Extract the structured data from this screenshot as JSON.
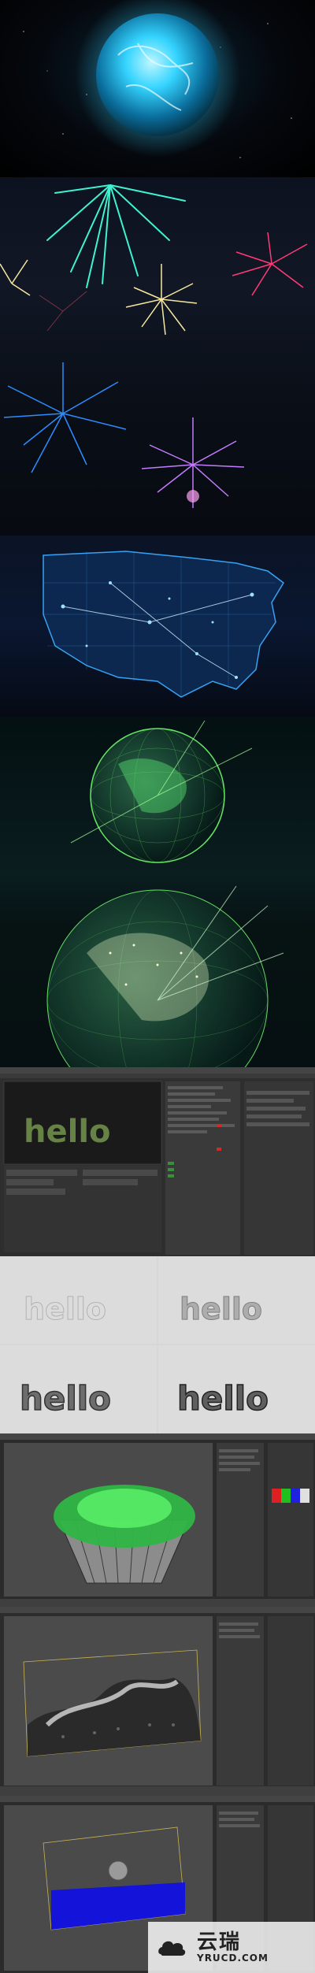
{
  "panels": [
    {
      "id": "plasma-sphere"
    },
    {
      "id": "fireworks"
    },
    {
      "id": "usa-network-map"
    },
    {
      "id": "earth-globes"
    },
    {
      "id": "c4d-hello-scene",
      "viewport_text": "hello"
    },
    {
      "id": "hello-render-sequence",
      "frames": [
        "hello",
        "hello",
        "hello",
        "hello"
      ]
    },
    {
      "id": "c4d-cupcake-scene"
    },
    {
      "id": "c4d-terrain-scene"
    },
    {
      "id": "c4d-fluid-scene"
    }
  ],
  "colors": {
    "plasma": "#35d4ff",
    "firework_cyan": "#3ff2d0",
    "firework_gold": "#f6e8a0",
    "firework_red": "#ff3a78",
    "firework_blue": "#2d8cff",
    "firework_purple": "#c37bff",
    "map_glow": "#3aa9ff",
    "earth_green": "#6cf06a",
    "fluid_blue": "#1010e0",
    "c4d_panel": "#3a3a3a"
  },
  "watermark": {
    "chinese": "云瑞",
    "domain": "YRUCD.COM"
  }
}
